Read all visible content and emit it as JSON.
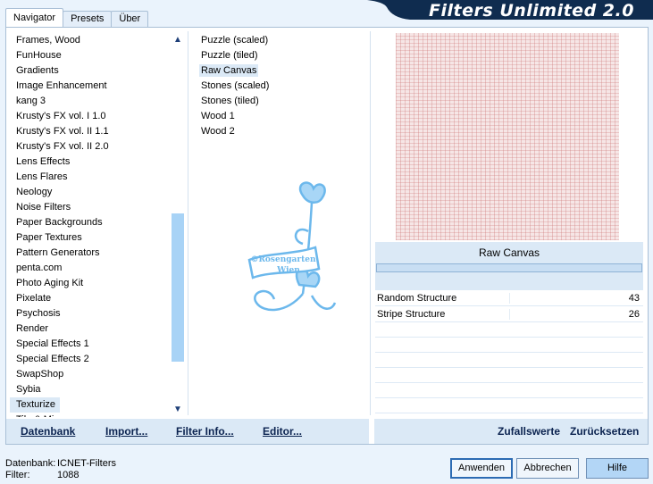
{
  "tabs": [
    "Navigator",
    "Presets",
    "Über"
  ],
  "banner": {
    "title": "Filters Unlimited 2.0",
    "bg_color": "#0f2c4f"
  },
  "categories": [
    "Frames, Wood",
    "FunHouse",
    "Gradients",
    "Image Enhancement",
    "kang 3",
    "Krusty's FX vol. I 1.0",
    "Krusty's FX vol. II 1.1",
    "Krusty's FX vol. II 2.0",
    "Lens Effects",
    "Lens Flares",
    "Neology",
    "Noise Filters",
    "Paper Backgrounds",
    "Paper Textures",
    "Pattern Generators",
    "penta.com",
    "Photo Aging Kit",
    "Pixelate",
    "Psychosis",
    "Render",
    "Special Effects 1",
    "Special Effects 2",
    "SwapShop",
    "Sybia",
    "Texturize",
    "Tile & Mirror"
  ],
  "selected_category": "Texturize",
  "filters": [
    "Puzzle (scaled)",
    "Puzzle (tiled)",
    "Raw Canvas",
    "Stones (scaled)",
    "Stones (tiled)",
    "Wood 1",
    "Wood 2"
  ],
  "selected_filter": "Raw Canvas",
  "watermark": {
    "line1": "©Rosengarten",
    "line2": "Wien"
  },
  "filter_name": "Raw Canvas",
  "params": [
    {
      "label": "Random Structure",
      "value": "43"
    },
    {
      "label": "Stripe Structure",
      "value": "26"
    }
  ],
  "left_buttons": {
    "database": "Datenbank",
    "import": "Import...",
    "filter_info": "Filter Info...",
    "editor": "Editor..."
  },
  "right_buttons": {
    "randomize": "Zufallswerte",
    "reset": "Zurücksetzen"
  },
  "footer": {
    "database_label": "Datenbank:",
    "database_value": "ICNET-Filters",
    "filter_label": "Filter:",
    "filter_value": "1088"
  },
  "dialog_buttons": {
    "apply": "Anwenden",
    "cancel": "Abbrechen",
    "help": "Hilfe"
  },
  "colors": {
    "accent": "#2c6bb3",
    "panel": "#dbe9f6",
    "watermark": "#6cb8ec",
    "scroll_thumb": "#a8d3f6"
  }
}
